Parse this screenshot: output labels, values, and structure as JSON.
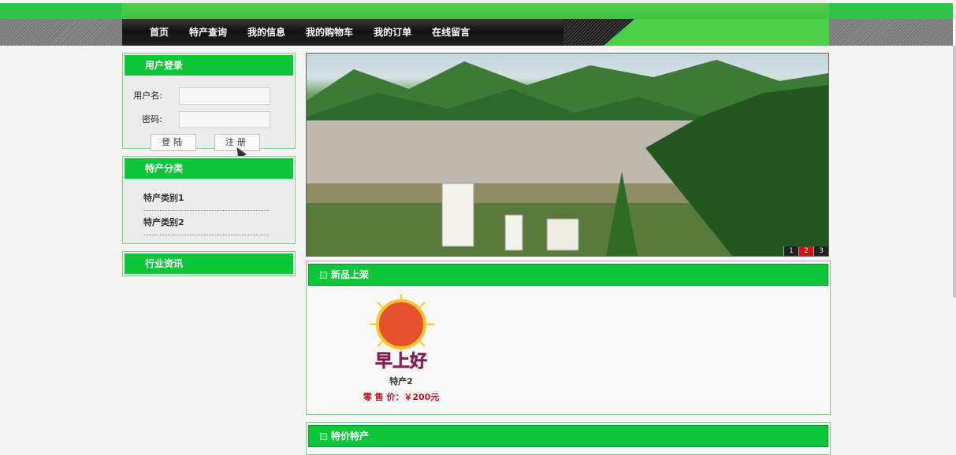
{
  "nav": {
    "items": [
      "首页",
      "特产查询",
      "我的信息",
      "我的购物车",
      "我的订单",
      "在线留言"
    ]
  },
  "login": {
    "title": "用户登录",
    "username_label": "用户名:",
    "password_label": "密码:",
    "login_button": "登陆",
    "register_button": "注册"
  },
  "category": {
    "title": "特产分类",
    "items": [
      "特产类别1",
      "特产类别2"
    ]
  },
  "news": {
    "title": "行业资讯"
  },
  "banner": {
    "pages": [
      "1",
      "2",
      "3"
    ],
    "active_page": "2"
  },
  "new_products": {
    "title": "新品上架",
    "product_name": "特产2",
    "price": "零 售 价：￥200元",
    "image_text": "早上好"
  },
  "sale_products": {
    "title": "特价特产"
  },
  "colors": {
    "brand_green": "#0fc63b",
    "price_red": "#b8141b"
  }
}
